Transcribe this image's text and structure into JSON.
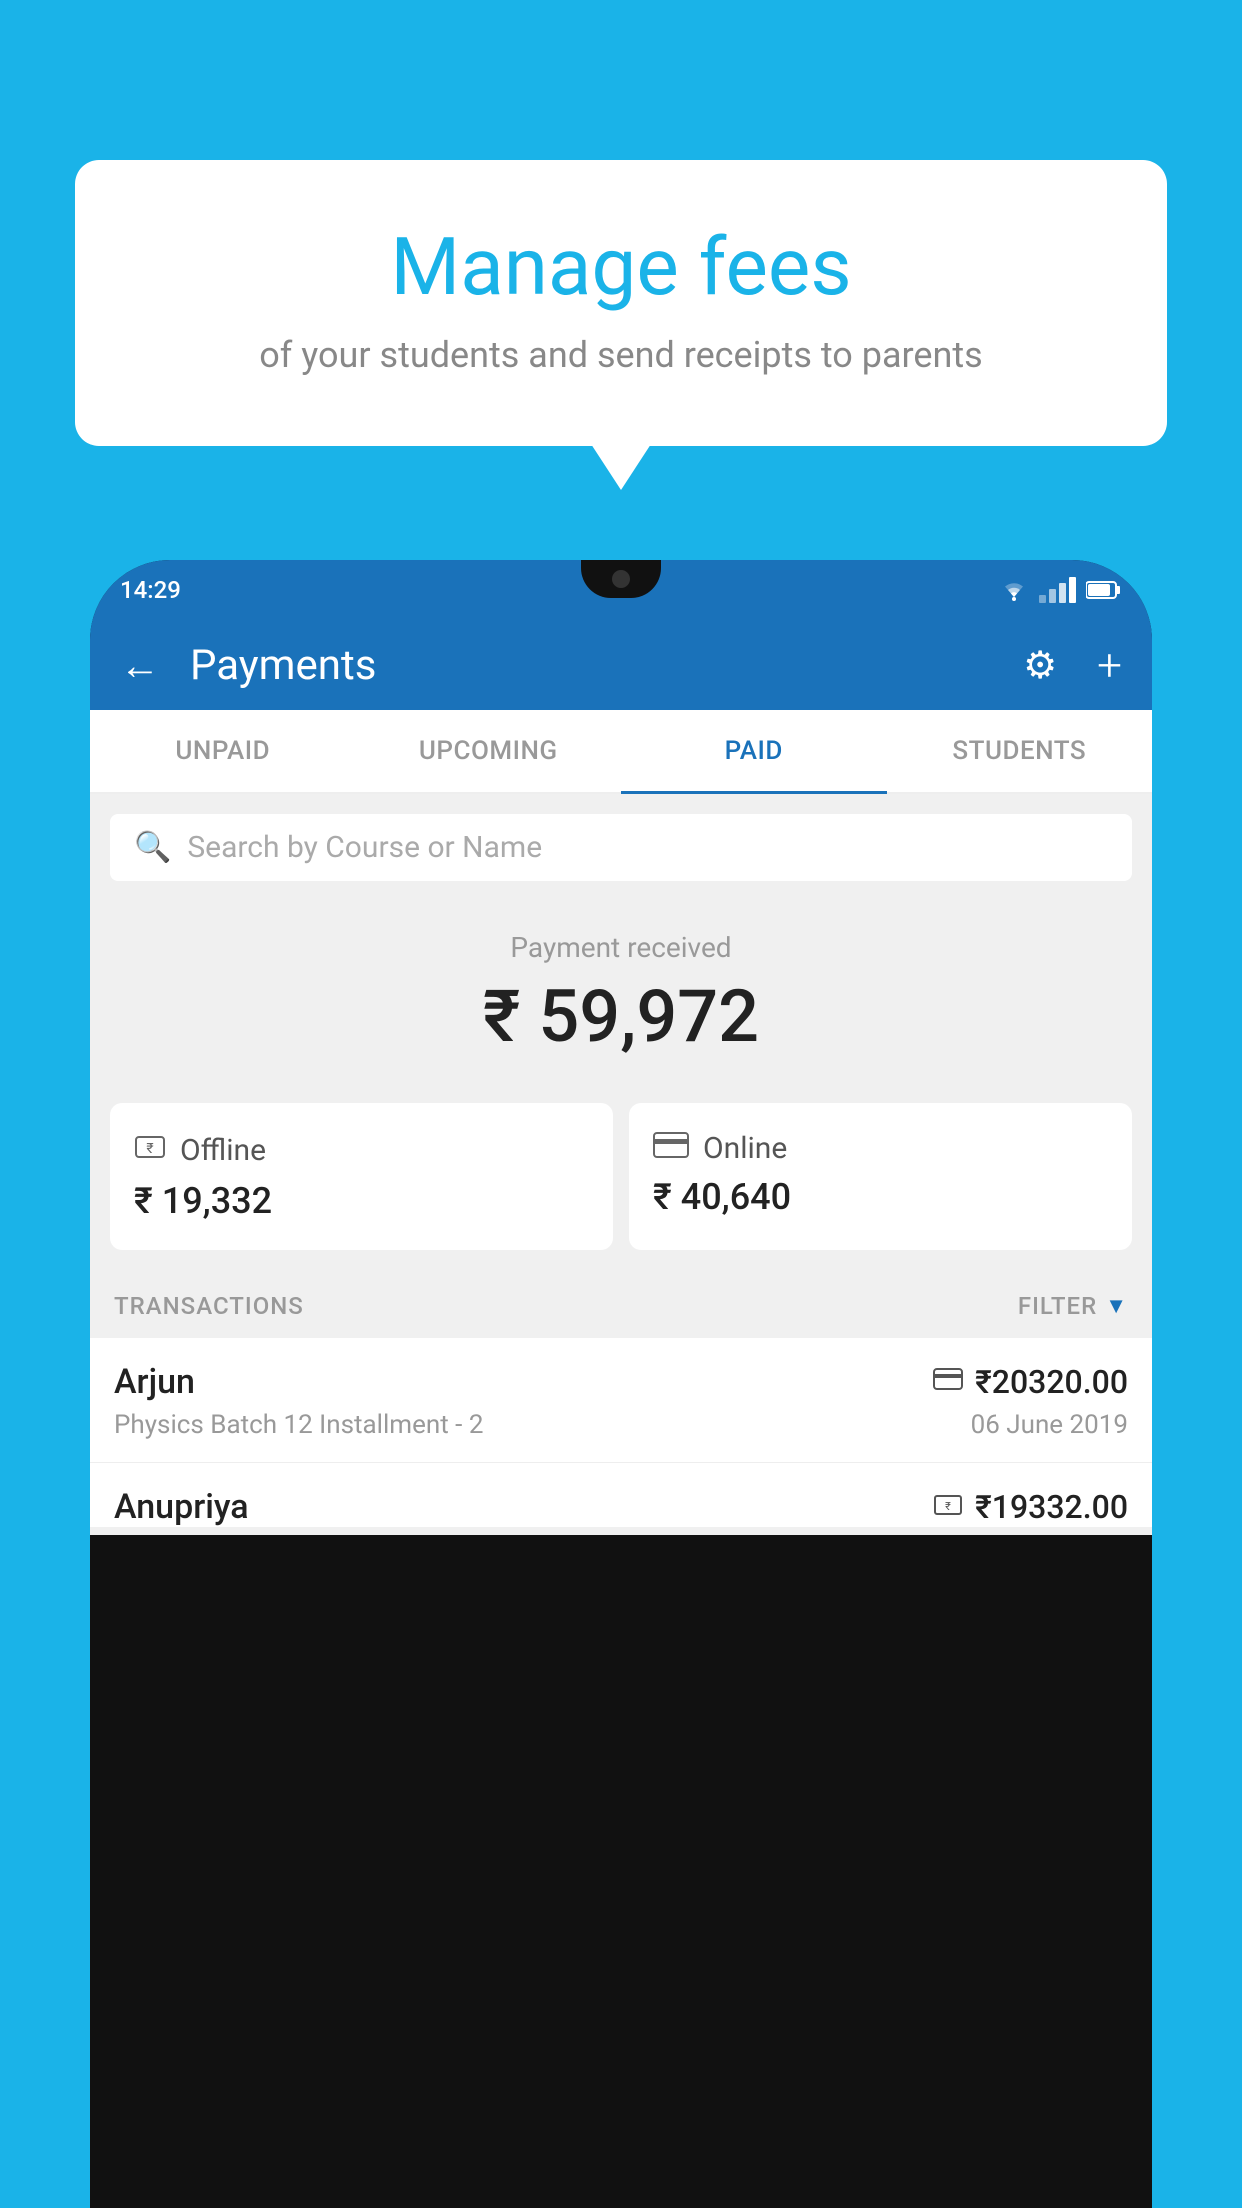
{
  "background_color": "#1ab3e8",
  "bubble": {
    "title": "Manage fees",
    "subtitle": "of your students and send receipts to parents"
  },
  "phone": {
    "status_bar": {
      "time": "14:29",
      "wifi_icon": "wifi",
      "battery_icon": "battery"
    },
    "header": {
      "back_label": "←",
      "title": "Payments",
      "gear_label": "⚙",
      "plus_label": "+"
    },
    "tabs": [
      {
        "id": "unpaid",
        "label": "UNPAID",
        "active": false
      },
      {
        "id": "upcoming",
        "label": "UPCOMING",
        "active": false
      },
      {
        "id": "paid",
        "label": "PAID",
        "active": true
      },
      {
        "id": "students",
        "label": "STUDENTS",
        "active": false
      }
    ],
    "search": {
      "placeholder": "Search by Course or Name"
    },
    "payment_summary": {
      "label": "Payment received",
      "amount": "₹ 59,972",
      "offline_label": "Offline",
      "offline_amount": "₹ 19,332",
      "online_label": "Online",
      "online_amount": "₹ 40,640"
    },
    "transactions": {
      "header_label": "TRANSACTIONS",
      "filter_label": "FILTER",
      "items": [
        {
          "name": "Arjun",
          "method_icon": "card",
          "amount": "₹20320.00",
          "course": "Physics Batch 12 Installment - 2",
          "date": "06 June 2019"
        },
        {
          "name": "Anupriya",
          "method_icon": "cash",
          "amount": "₹19332.00",
          "course": "",
          "date": ""
        }
      ]
    }
  }
}
